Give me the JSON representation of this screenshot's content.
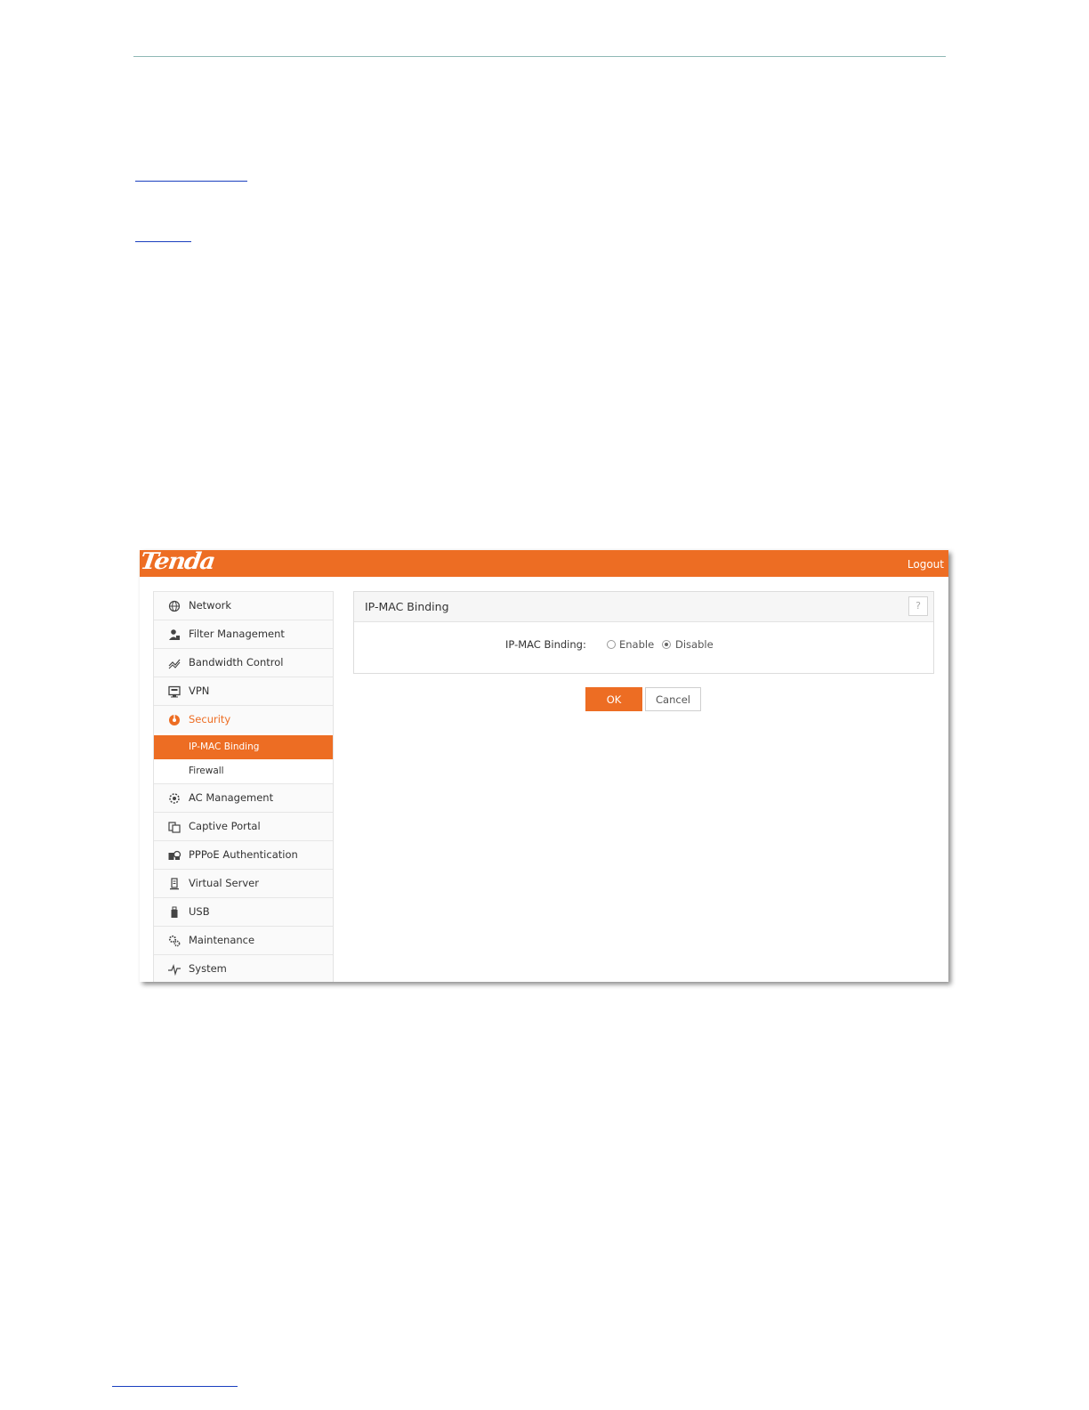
{
  "header": {
    "logo_text": "Tenda",
    "logout_label": "Logout"
  },
  "sidebar": {
    "items": [
      {
        "label": "Network",
        "icon": "globe-icon"
      },
      {
        "label": "Filter Management",
        "icon": "user-filter-icon"
      },
      {
        "label": "Bandwidth Control",
        "icon": "bandwidth-icon"
      },
      {
        "label": "VPN",
        "icon": "monitor-icon"
      },
      {
        "label": "Security",
        "icon": "shield-icon",
        "active": true
      },
      {
        "label": "AC Management",
        "icon": "ac-gear-icon"
      },
      {
        "label": "Captive Portal",
        "icon": "portal-icon"
      },
      {
        "label": "PPPoE Authentication",
        "icon": "pppoe-icon"
      },
      {
        "label": "Virtual Server",
        "icon": "server-icon"
      },
      {
        "label": "USB",
        "icon": "usb-icon"
      },
      {
        "label": "Maintenance",
        "icon": "gears-icon"
      },
      {
        "label": "System",
        "icon": "pulse-icon"
      }
    ],
    "security_sub": [
      {
        "label": "IP-MAC Binding",
        "active": true
      },
      {
        "label": "Firewall",
        "active": false
      }
    ]
  },
  "main": {
    "panel_title": "IP-MAC Binding",
    "help_label": "?",
    "field_label": "IP-MAC Binding:",
    "options": [
      {
        "label": "Enable",
        "selected": false
      },
      {
        "label": "Disable",
        "selected": true
      }
    ],
    "ok_label": "OK",
    "cancel_label": "Cancel"
  },
  "colors": {
    "accent": "#ed6d23"
  }
}
